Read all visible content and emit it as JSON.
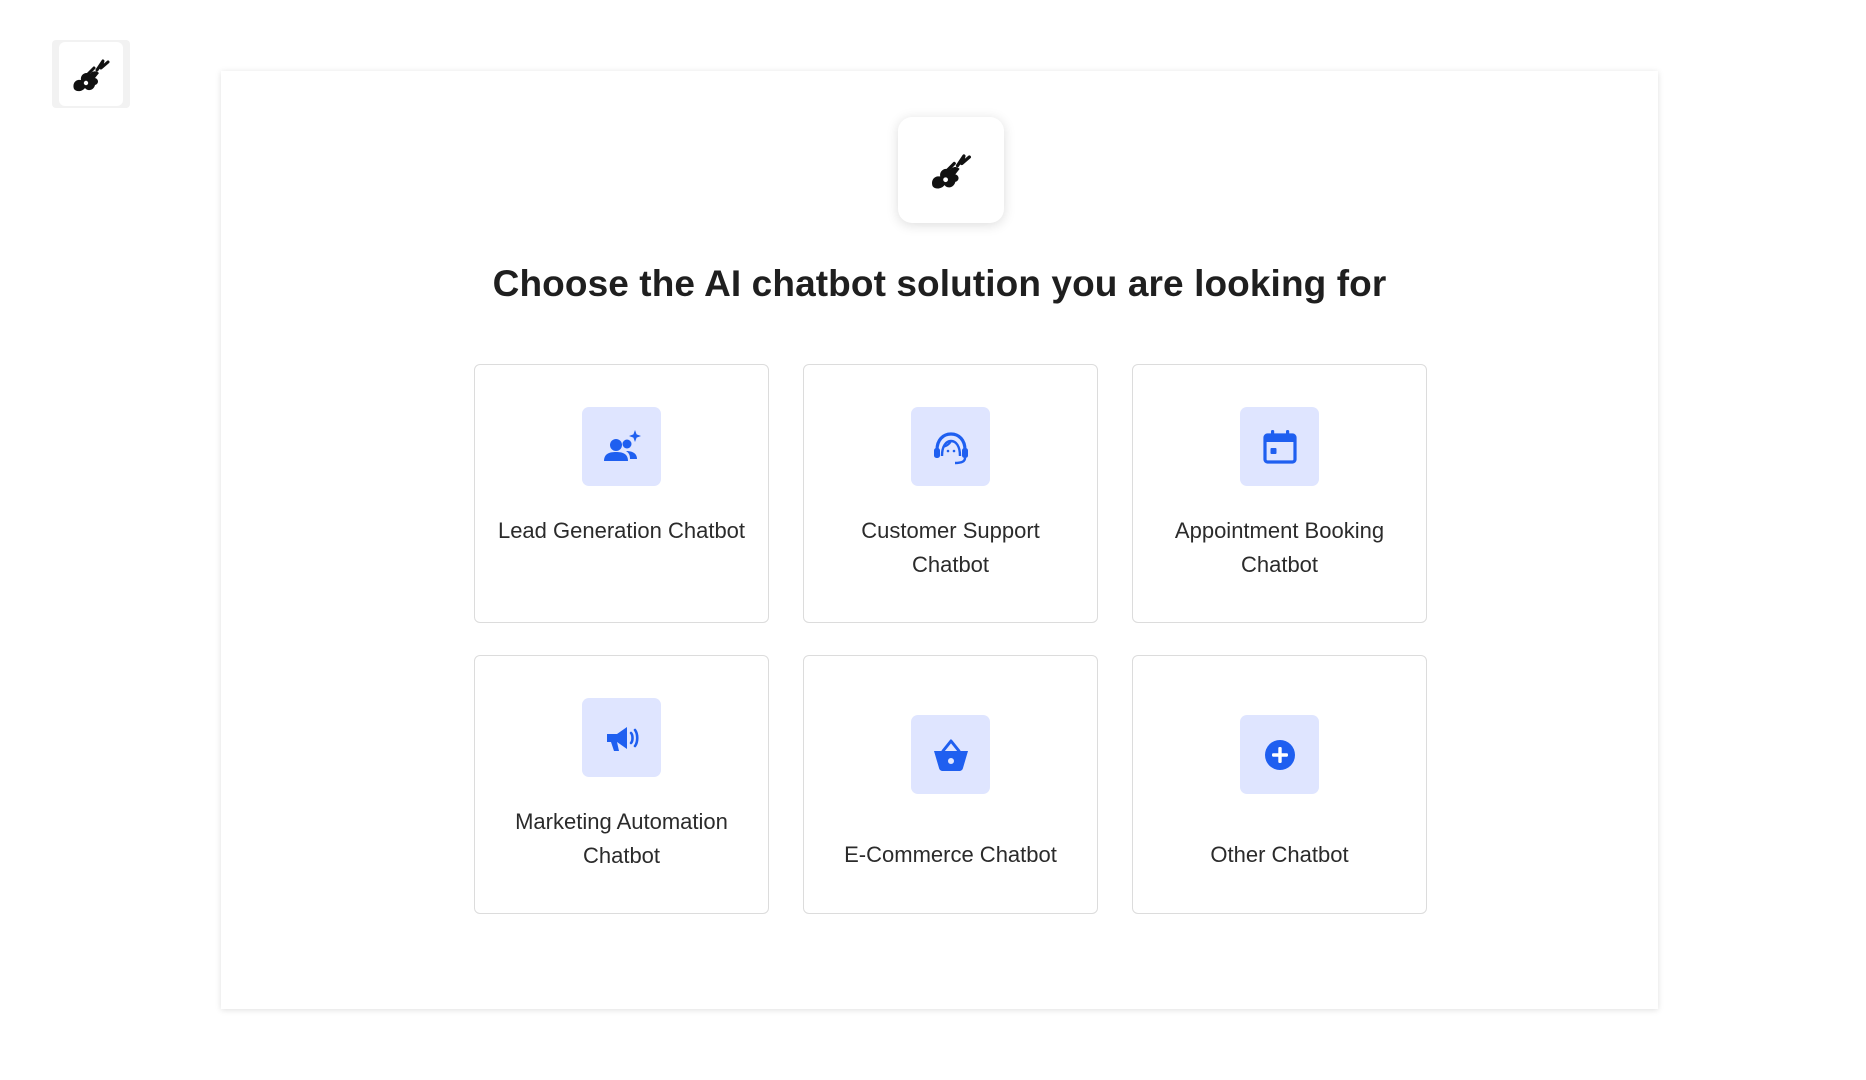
{
  "brand": {
    "logo_icon": "guitar-plug-icon",
    "accent": "#1f5ff0",
    "icon_bg": "#dfe5ff"
  },
  "page": {
    "title": "Choose the AI chatbot solution you are looking for"
  },
  "options": [
    {
      "label": "Lead Generation Chatbot",
      "icon": "users-sparkle-icon"
    },
    {
      "label": "Customer Support Chatbot",
      "icon": "headset-agent-icon"
    },
    {
      "label": "Appointment Booking Chatbot",
      "icon": "calendar-icon"
    },
    {
      "label": "Marketing Automation Chatbot",
      "icon": "megaphone-icon"
    },
    {
      "label": "E-Commerce Chatbot",
      "icon": "shopping-basket-icon"
    },
    {
      "label": "Other Chatbot",
      "icon": "plus-circle-icon"
    }
  ]
}
